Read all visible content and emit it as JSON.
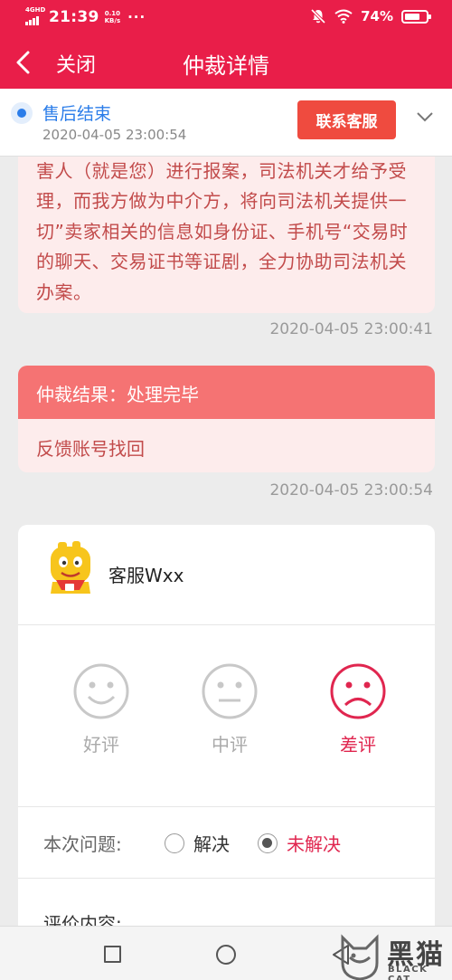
{
  "status_bar": {
    "network": "4GHD",
    "time": "21:39",
    "speed_value": "0.10",
    "speed_unit": "KB/s",
    "more": "···",
    "battery_text": "74%",
    "battery_level": 0.74
  },
  "nav": {
    "close_label": "关闭",
    "title": "仲裁详情"
  },
  "status": {
    "label": "售后结束",
    "time": "2020-04-05 23:00:54",
    "contact_button": "联系客服"
  },
  "messages": {
    "message_text": "害人（就是您）进行报案，司法机关才给予受理，而我方做为中介方，将向司法机关提供一切”卖家相关的信息如身份证、手机号“交易时的聊天、交易证书等证剧，全力协助司法机关办案。",
    "message_time": "2020-04-05 23:00:41",
    "result_title": "仲裁结果：处理完毕",
    "result_body": "反馈账号找回",
    "result_time": "2020-04-05 23:00:54"
  },
  "rating": {
    "agent_name": "客服Wxx",
    "good_label": "好评",
    "neutral_label": "中评",
    "bad_label": "差评",
    "selected": "差评",
    "question_label": "本次问题:",
    "option_resolved": "解决",
    "option_unresolved": "未解决",
    "question_selected": "未解决",
    "eval_label": "评价内容:"
  },
  "watermark": {
    "text": "黑猫",
    "sub": "BLACK CAT"
  },
  "colors": {
    "brand": "#e91e49",
    "accent_blue": "#2b7de9",
    "contact_button": "#ef4b3f",
    "result_header": "#f57373",
    "message_bg": "#fdecec",
    "message_text": "#c24b4b",
    "bad_rating": "#e0264f",
    "inactive": "#c8c8c8"
  }
}
